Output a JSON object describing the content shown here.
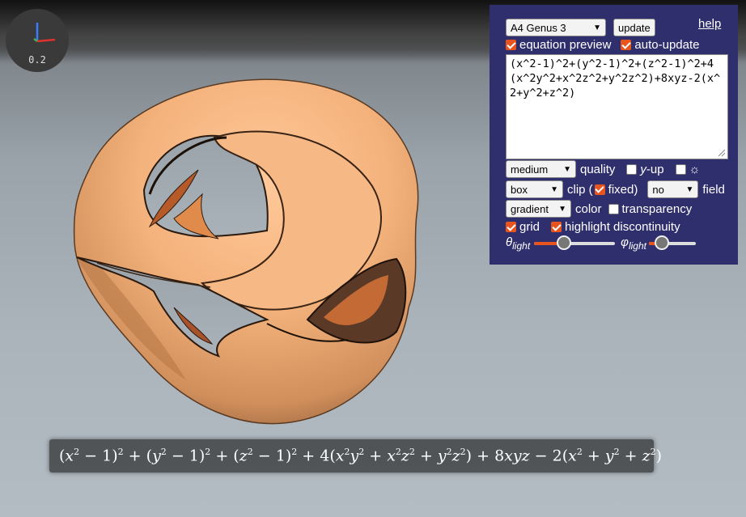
{
  "axes_widget": {
    "scale_label": "0.2"
  },
  "panel": {
    "surface_select": "A4 Genus 3",
    "update_label": "update",
    "help_label": "help",
    "equation_preview_label": "equation preview",
    "auto_update_label": "auto-update",
    "equation_text": "(x^2-1)^2+(y^2-1)^2+(z^2-1)^2+4(x^2y^2+x^2z^2+y^2z^2)+8xyz-2(x^2+y^2+z^2)",
    "quality_select": "medium",
    "quality_label": "quality",
    "y_up_label": "-up",
    "y_up_var": "y",
    "light_toggle_icon": "☼",
    "clip_select": "box",
    "clip_label": "clip (",
    "fixed_label": "fixed)",
    "field_select": "no",
    "field_label": "field",
    "color_select": "gradient",
    "color_label": "color",
    "transparency_label": "transparency",
    "grid_label": "grid",
    "highlight_label": "highlight discontinuity",
    "theta_symbol": "θ",
    "phi_symbol": "φ",
    "light_sub": "light",
    "theta_light_value": 0.37,
    "phi_light_value": 0.27,
    "checkboxes": {
      "equation_preview": true,
      "auto_update": true,
      "y_up": false,
      "light_toggle": false,
      "fixed": true,
      "transparency": false,
      "grid": true,
      "highlight_discontinuity": true
    }
  },
  "colors": {
    "accent": "#e8541e",
    "panel_bg": "#2f2f6e",
    "surface": "#f2b07a"
  }
}
